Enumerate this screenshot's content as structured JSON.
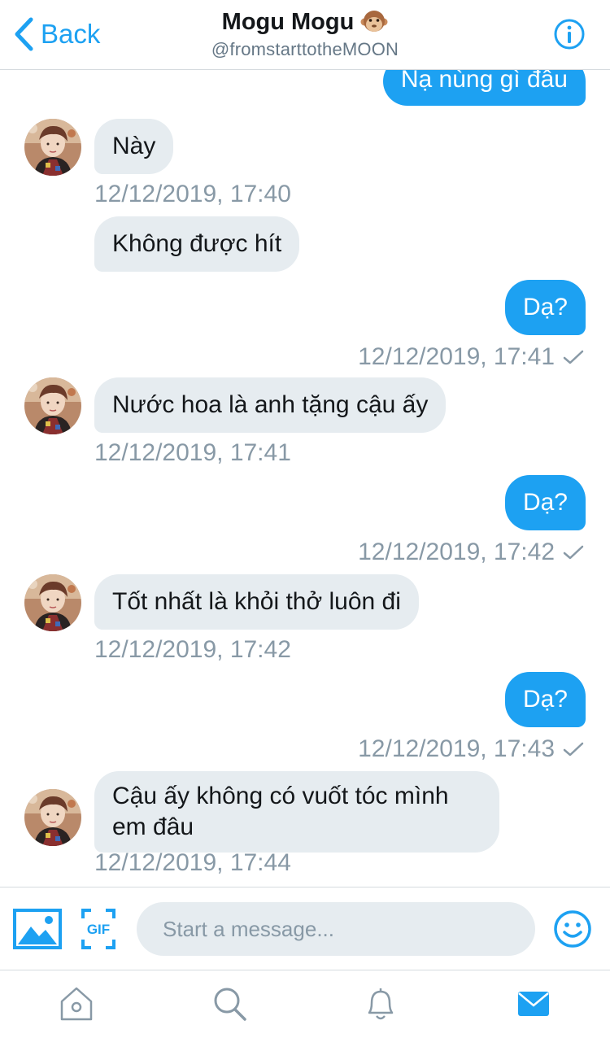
{
  "header": {
    "back_label": "Back",
    "title": "Mogu Mogu",
    "title_emoji": "monkey-face",
    "handle": "@fromstarttotheMOON"
  },
  "messages": [
    {
      "side": "out",
      "text": "Nạ nùng gì đâu"
    },
    {
      "side": "in",
      "text": "Này"
    },
    {
      "side": "in",
      "timestamp": "12/12/2019, 17:40"
    },
    {
      "side": "in",
      "text": "Không được hít"
    },
    {
      "side": "out",
      "text": "Dạ?"
    },
    {
      "side": "out",
      "timestamp": "12/12/2019, 17:41"
    },
    {
      "side": "in",
      "text": "Nước hoa là anh tặng cậu ấy"
    },
    {
      "side": "in",
      "timestamp": "12/12/2019, 17:41"
    },
    {
      "side": "out",
      "text": "Dạ?"
    },
    {
      "side": "out",
      "timestamp": "12/12/2019, 17:42"
    },
    {
      "side": "in",
      "text": "Tốt nhất là khỏi thở luôn đi"
    },
    {
      "side": "in",
      "timestamp": "12/12/2019, 17:42"
    },
    {
      "side": "out",
      "text": "Dạ?"
    },
    {
      "side": "out",
      "timestamp": "12/12/2019, 17:43"
    },
    {
      "side": "in",
      "text_line1": "Cậu ấy không có vuốt tóc mình",
      "text_line2": "em đâu"
    },
    {
      "side": "in",
      "timestamp": "12/12/2019, 17:44"
    }
  ],
  "composer": {
    "placeholder": "Start a message...",
    "gif_label": "GIF"
  },
  "tabbar": {
    "items": [
      "home-icon",
      "search-icon",
      "notifications-icon",
      "messages-icon"
    ],
    "active": "messages-icon"
  },
  "colors": {
    "accent": "#1da1f2",
    "incoming_bubble": "#e6ecf0",
    "timestamp": "#8899a6",
    "icon_gray": "#8899a6"
  }
}
